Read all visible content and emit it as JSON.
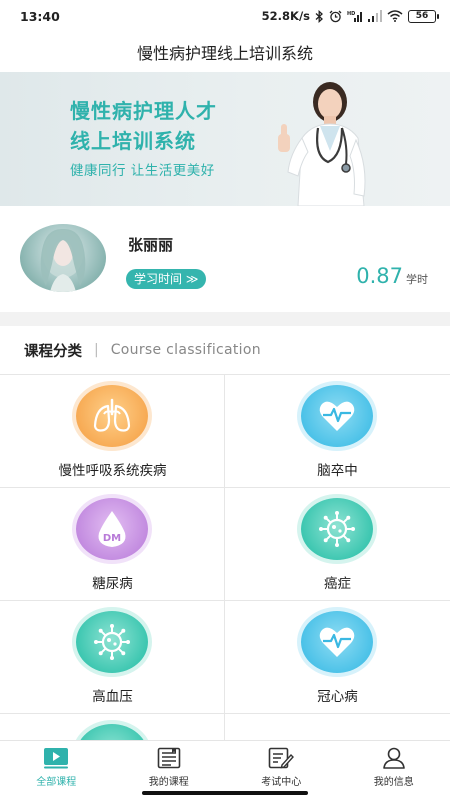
{
  "status_bar": {
    "time": "13:40",
    "speed": "52.8K/s",
    "battery": "56"
  },
  "header": {
    "title": "慢性病护理线上培训系统"
  },
  "banner": {
    "title_line1": "慢性病护理人才",
    "title_line2": "线上培训系统",
    "subtitle": "健康同行  让生活更美好"
  },
  "profile": {
    "name": "张丽丽",
    "study_time_label": "学习时间 ≫",
    "hours_value": "0.87",
    "hours_unit": "学时"
  },
  "section": {
    "title": "课程分类",
    "divider": "|",
    "subtitle": "Course classification"
  },
  "categories": [
    {
      "label": "慢性呼吸系统疾病",
      "icon": "lungs-icon",
      "color": "#f4a24a"
    },
    {
      "label": "脑卒中",
      "icon": "heartbeat-icon",
      "color": "#3ab8e2"
    },
    {
      "label": "糖尿病",
      "icon": "dm-drop-icon",
      "color": "#b87ad8"
    },
    {
      "label": "癌症",
      "icon": "virus-icon",
      "color": "#2fbfa8"
    },
    {
      "label": "高血压",
      "icon": "virus-icon",
      "color": "#2fbfa8"
    },
    {
      "label": "冠心病",
      "icon": "heartbeat-icon",
      "color": "#3ab8e2"
    }
  ],
  "bottom_nav": {
    "items": [
      {
        "label": "全部课程",
        "icon": "play-video-icon",
        "active": true
      },
      {
        "label": "我的课程",
        "icon": "course-list-icon",
        "active": false
      },
      {
        "label": "考试中心",
        "icon": "exam-edit-icon",
        "active": false
      },
      {
        "label": "我的信息",
        "icon": "user-icon",
        "active": false
      }
    ]
  },
  "colors": {
    "accent": "#2fb2ac",
    "banner_bg": "#e6eeef"
  }
}
